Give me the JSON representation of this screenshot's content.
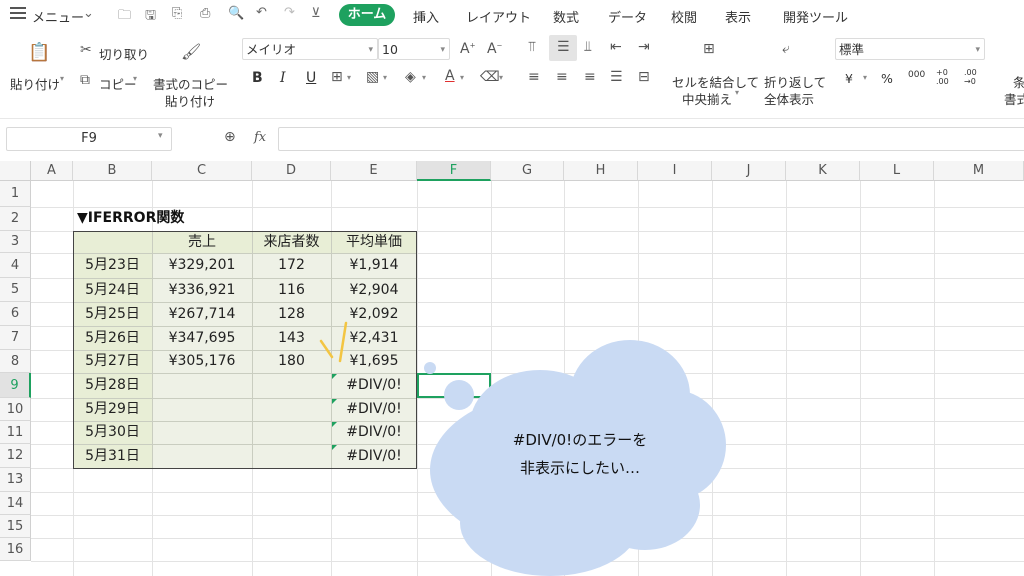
{
  "menubar": {
    "menu_label": "メニュー",
    "tabs": [
      "ホーム",
      "挿入",
      "レイアウト",
      "数式",
      "データ",
      "校閲",
      "表示",
      "開発ツール"
    ]
  },
  "ribbon": {
    "paste": "貼り付け",
    "cut": "切り取り",
    "copy": "コピー",
    "format_painter_line1": "書式のコピー",
    "format_painter_line2": "貼り付け",
    "font_name": "メイリオ",
    "font_size": "10",
    "bold": "B",
    "italic": "I",
    "underline": "U",
    "merge_line1": "セルを結合して",
    "merge_line2": "中央揃え",
    "wrap_line1": "折り返して",
    "wrap_line2": "全体表示",
    "number_format": "標準",
    "currency": "¥",
    "percent": "%",
    "thousands": "000",
    "dec_inc": "+0\n.00",
    "dec_dec": ".00\n→0",
    "conditional_partial": "条",
    "conditional_partial2": "書式"
  },
  "formula_bar": {
    "name_box": "F9",
    "fx": "fx",
    "value": ""
  },
  "grid": {
    "columns": [
      "A",
      "B",
      "C",
      "D",
      "E",
      "F",
      "G",
      "H",
      "I",
      "J",
      "K",
      "L",
      "M"
    ],
    "rows": [
      "1",
      "2",
      "3",
      "4",
      "5",
      "6",
      "7",
      "8",
      "9",
      "10",
      "11",
      "12",
      "13",
      "14",
      "15",
      "16"
    ],
    "selected_cell": "F9",
    "title": "▼IFERROR関数",
    "headers": [
      "",
      "売上",
      "来店者数",
      "平均単価"
    ],
    "table": [
      [
        "5月23日",
        "¥329,201",
        "172",
        "¥1,914"
      ],
      [
        "5月24日",
        "¥336,921",
        "116",
        "¥2,904"
      ],
      [
        "5月25日",
        "¥267,714",
        "128",
        "¥2,092"
      ],
      [
        "5月26日",
        "¥347,695",
        "143",
        "¥2,431"
      ],
      [
        "5月27日",
        "¥305,176",
        "180",
        "¥1,695"
      ],
      [
        "5月28日",
        "",
        "",
        "#DIV/0!"
      ],
      [
        "5月29日",
        "",
        "",
        "#DIV/0!"
      ],
      [
        "5月30日",
        "",
        "",
        "#DIV/0!"
      ],
      [
        "5月31日",
        "",
        "",
        "#DIV/0!"
      ]
    ]
  },
  "bubble": {
    "line1": "#DIV/0!のエラーを",
    "line2": "非表示にしたい…",
    "color": "#c9daf3"
  },
  "colors": {
    "accent": "#1ea15f",
    "table_fill": "#eef1e6",
    "emphasis_stroke": "#f3c542"
  }
}
